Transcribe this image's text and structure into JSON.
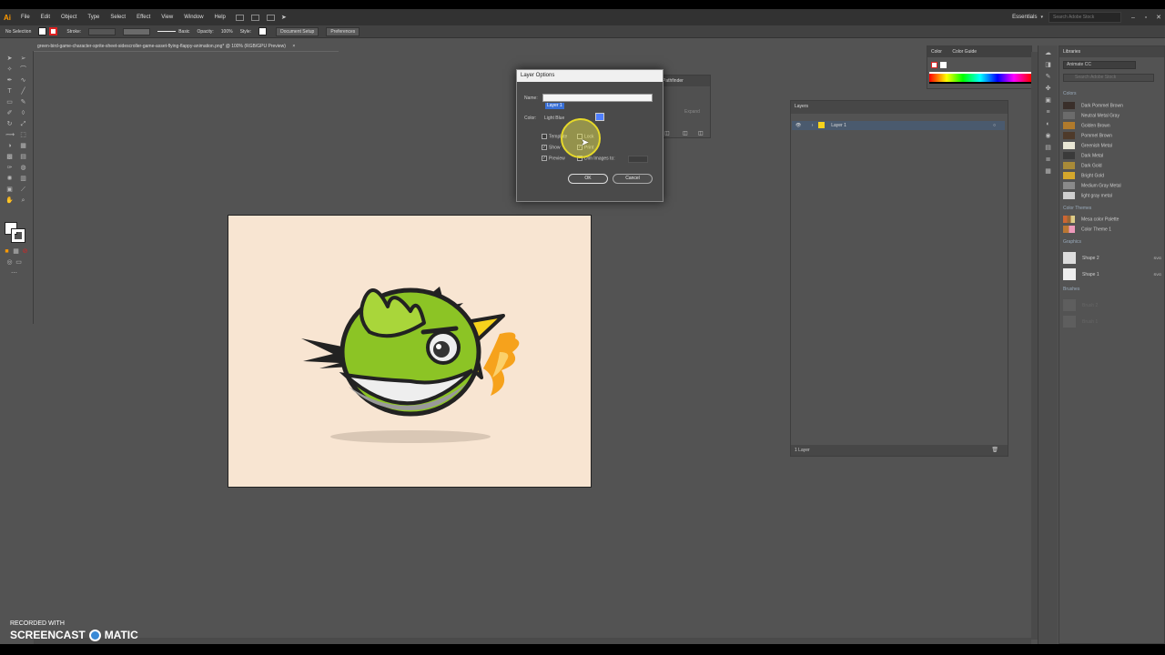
{
  "menubar": {
    "logo": "Ai",
    "items": [
      "File",
      "Edit",
      "Object",
      "Type",
      "Select",
      "Effect",
      "View",
      "Window",
      "Help"
    ],
    "workspace": "Essentials",
    "search_placeholder": "Search Adobe Stock"
  },
  "control_bar": {
    "selection": "No Selection",
    "stroke_label": "Stroke:",
    "brush": "Basic",
    "opacity_label": "Opacity:",
    "opacity_value": "100%",
    "style_label": "Style:",
    "document_setup": "Document Setup",
    "preferences": "Preferences"
  },
  "document_tab": {
    "title": "green-bird-game-character-sprite-sheet-sidescroller-game-asset-flying-flappy-animation.png* @ 100% (RGB/GPU Preview)",
    "close": "×"
  },
  "layer_options_dialog": {
    "title": "Layer Options",
    "name_label": "Name:",
    "name_value": "Layer 1",
    "color_label": "Color:",
    "color_value": "Light Blue",
    "template_label": "Template",
    "lock_label": "Lock",
    "show_label": "Show",
    "print_label": "Print",
    "preview_label": "Preview",
    "dim_images_label": "Dim Images to:",
    "ok_label": "OK",
    "cancel_label": "Cancel"
  },
  "pathfinder_panel": {
    "title": "Pathfinder",
    "expand": "Expand"
  },
  "color_panel": {
    "tab_color": "Color",
    "tab_guide": "Color Guide"
  },
  "layers_panel": {
    "title": "Layers",
    "layer_name": "Layer 1",
    "footer": "1 Layer"
  },
  "libraries_panel": {
    "title": "Libraries",
    "library_name": "Animate CC",
    "search_placeholder": "Search Adobe Stock",
    "colors_header": "Colors",
    "colors": [
      {
        "name": "Dark Pommel Brown",
        "hex": "#3a2f2a"
      },
      {
        "name": "Neutral Metal Gray",
        "hex": "#6b6b6b"
      },
      {
        "name": "Golden Brown",
        "hex": "#b07a2c"
      },
      {
        "name": "Pommel Brown",
        "hex": "#4e3a2a"
      },
      {
        "name": "Greenish Metal",
        "hex": "#e8e6d4"
      },
      {
        "name": "Dark Metal",
        "hex": "#3a3a3a"
      },
      {
        "name": "Dark Gold",
        "hex": "#a88a38"
      },
      {
        "name": "Bright Gold",
        "hex": "#d4a72c"
      },
      {
        "name": "Medium Gray Metal",
        "hex": "#8a8a8a"
      },
      {
        "name": "light gray metal",
        "hex": "#cfcfcf"
      }
    ],
    "themes_header": "Color Themes",
    "themes": [
      "Mesa color Palette",
      "Color Theme 1"
    ],
    "graphics_header": "Graphics",
    "graphics": [
      {
        "name": "Shape 2",
        "badge": "SVG"
      },
      {
        "name": "Shape 1",
        "badge": "SVG"
      }
    ],
    "brushes_header": "Brushes",
    "brushes": [
      "Brush 2",
      "Brush 1"
    ]
  },
  "watermark": {
    "line1": "RECORDED WITH",
    "line2": "SCREENCAST",
    "line3": "MATIC"
  },
  "colors": {
    "app_bg": "#535353",
    "artboard": "#f8e5d2",
    "bird_green": "#8cc425",
    "flame": "#f6a21c",
    "selection": "#3a70d6"
  }
}
